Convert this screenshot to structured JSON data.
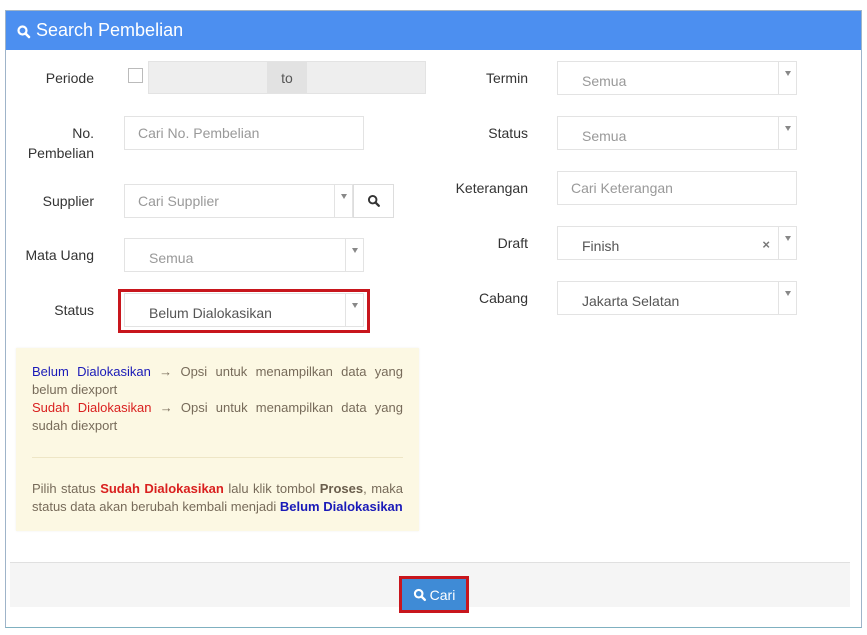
{
  "panel": {
    "title": "Search Pembelian",
    "title_icon": "search-icon"
  },
  "left": {
    "periode": {
      "label": "Periode",
      "range_separator": "to",
      "checked": false
    },
    "no_pembelian": {
      "label_line1": "No.",
      "label_line2": "Pembelian",
      "placeholder": "Cari No. Pembelian"
    },
    "supplier": {
      "label": "Supplier",
      "placeholder": "Cari Supplier",
      "button_icon": "search-icon"
    },
    "mata_uang": {
      "label": "Mata Uang",
      "value": "Semua"
    },
    "status": {
      "label": "Status",
      "value": "Belum Dialokasikan"
    }
  },
  "right": {
    "termin": {
      "label": "Termin",
      "value": "Semua"
    },
    "status": {
      "label": "Status",
      "value": "Semua"
    },
    "keterangan": {
      "label": "Keterangan",
      "placeholder": "Cari Keterangan"
    },
    "draft": {
      "label": "Draft",
      "value": "Finish",
      "clear": "×"
    },
    "cabang": {
      "label": "Cabang",
      "value": "Jakarta Selatan"
    }
  },
  "info": {
    "line1_term": "Belum Dialokasikan",
    "line1_arrow": "→",
    "line1_text": "Opsi untuk menampilkan data yang belum diexport",
    "line2_term": "Sudah Dialokasikan",
    "line2_arrow": "→",
    "line2_text": "Opsi untuk menampilkan data yang sudah diexport",
    "note_prefix": "Pilih status",
    "note_status": "Sudah Dialokasikan",
    "note_mid": "lalu klik tombol",
    "note_button": "Proses",
    "note_suffix": ", maka status data akan berubah kembali menjadi",
    "note_result": "Belum Dialokasikan"
  },
  "footer": {
    "search_button": "Cari",
    "search_icon": "search-icon"
  },
  "colors": {
    "header": "#4c8ff0",
    "highlight": "#c8161d",
    "button": "#3f8bd6",
    "info_bg": "#fcf8e3",
    "term_blue": "#1a1ab8",
    "term_red": "#d9201f"
  }
}
